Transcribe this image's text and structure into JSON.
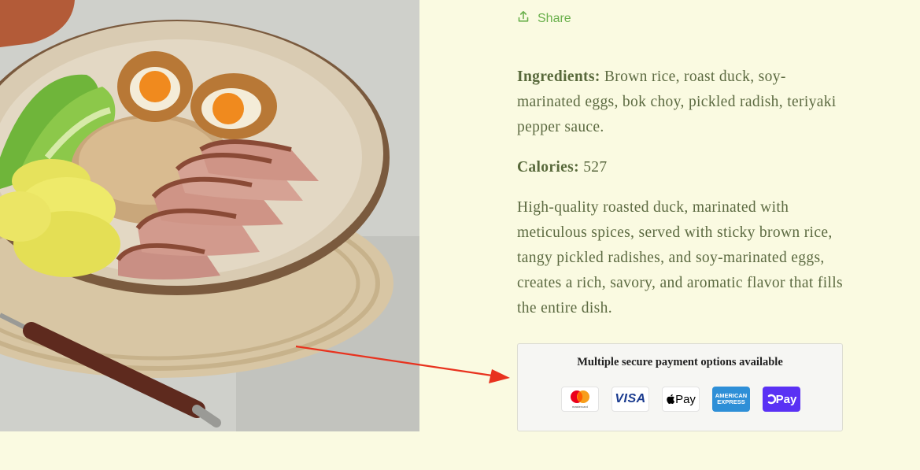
{
  "share": {
    "label": "Share",
    "icon": "share-upload-icon",
    "color": "#6ab04c"
  },
  "product": {
    "image_alt": "Roast duck bowl with brown rice, soy-marinated eggs, bok choy and pickled radish",
    "ingredients_label": "Ingredients:",
    "ingredients_text": " Brown rice, roast duck, soy-marinated eggs, bok choy, pickled radish, teriyaki pepper sauce.",
    "calories_label": "Calories:",
    "calories_value": " 527",
    "description": "High-quality roasted duck, marinated with meticulous spices, served with  sticky brown rice,  tangy pickled radishes,  and soy-marinated eggs, creates a rich, savory, and aromatic flavor that fills the entire dish."
  },
  "payment": {
    "title": "Multiple secure payment options available",
    "methods": [
      {
        "name": "Mastercard",
        "icon": "mastercard-icon",
        "label": "mastercard"
      },
      {
        "name": "Visa",
        "icon": "visa-icon",
        "label": "VISA"
      },
      {
        "name": "Apple Pay",
        "icon": "apple-pay-icon",
        "label": "Pay"
      },
      {
        "name": "American Express",
        "icon": "amex-icon",
        "label_line1": "AMERICAN",
        "label_line2": "EXPRESS"
      },
      {
        "name": "Shop Pay",
        "icon": "shop-pay-icon",
        "label": "Pay"
      }
    ]
  },
  "colors": {
    "background": "#fafae1",
    "text": "#5c6a41",
    "accent_green": "#6ab04c",
    "annotation_red": "#e8321e"
  }
}
